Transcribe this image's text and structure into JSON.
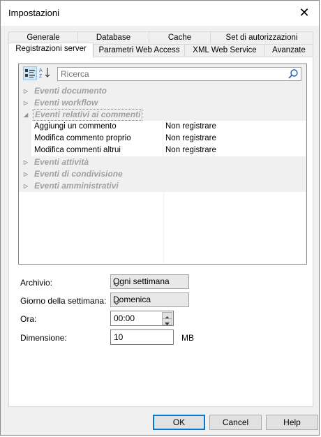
{
  "window": {
    "title": "Impostazioni"
  },
  "tabs_back": [
    "Generale",
    "Database",
    "Cache",
    "Set di autorizzazioni"
  ],
  "tabs_front": [
    "Registrazioni server",
    "Parametri Web Access",
    "XML Web Service",
    "Avanzate"
  ],
  "active_tab": "Registrazioni server",
  "search": {
    "placeholder": "Ricerca"
  },
  "categories": [
    {
      "label": "Eventi documento",
      "expanded": false
    },
    {
      "label": "Eventi workflow",
      "expanded": false
    },
    {
      "label": "Eventi relativi ai commenti",
      "expanded": true,
      "selected": true
    },
    {
      "label": "Eventi attività",
      "expanded": false
    },
    {
      "label": "Eventi di condivisione",
      "expanded": false
    },
    {
      "label": "Eventi amministrativi",
      "expanded": false
    }
  ],
  "comment_properties": [
    {
      "name": "Aggiungi un commento",
      "value": "Non registrare"
    },
    {
      "name": "Modifica commento proprio",
      "value": "Non registrare"
    },
    {
      "name": "Modifica commenti altrui",
      "value": "Non registrare"
    }
  ],
  "form": {
    "archivio_label": "Archivio:",
    "archivio_value": "Ogni settimana",
    "giorno_label": "Giorno della settimana:",
    "giorno_value": "Domenica",
    "ora_label": "Ora:",
    "ora_value": "00:00",
    "dimensione_label": "Dimensione:",
    "dimensione_value": "10",
    "dimensione_unit": "MB"
  },
  "buttons": {
    "ok": "OK",
    "cancel": "Cancel",
    "help": "Help"
  },
  "colors": {
    "accent": "#0078d7",
    "category_text": "#a0a0a0"
  }
}
